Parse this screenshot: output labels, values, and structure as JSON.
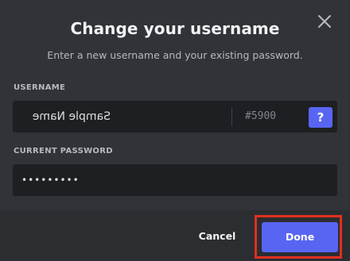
{
  "dialog": {
    "title": "Change your username",
    "subtitle": "Enter a new username and your existing password."
  },
  "username": {
    "label": "USERNAME",
    "value": "Sample Name",
    "discriminator": "#5900",
    "help_label": "?"
  },
  "password": {
    "label": "CURRENT PASSWORD",
    "value": "•••••••••"
  },
  "footer": {
    "cancel_label": "Cancel",
    "done_label": "Done"
  },
  "colors": {
    "background": "#313338",
    "footer": "#2b2d31",
    "input": "#1e1f22",
    "accent": "#5865f2",
    "highlight": "#e0301e"
  },
  "icons": {
    "close": "close-icon"
  }
}
